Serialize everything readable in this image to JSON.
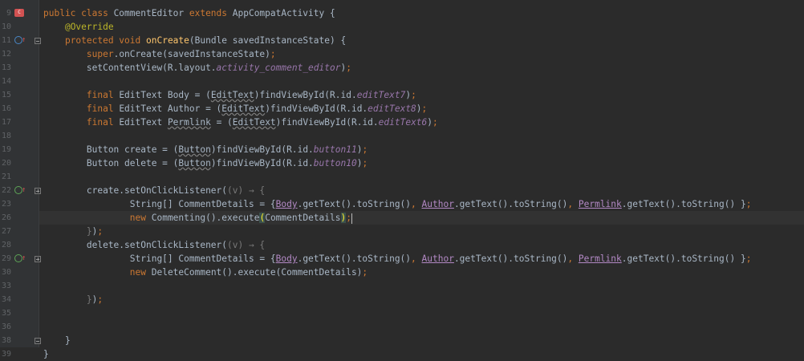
{
  "editor": {
    "line_numbers": [
      "9",
      "10",
      "11",
      "12",
      "13",
      "14",
      "15",
      "16",
      "17",
      "18",
      "19",
      "20",
      "21",
      "22",
      "23",
      "26",
      "27",
      "28",
      "29",
      "30",
      "33",
      "34",
      "35",
      "36",
      "38",
      "39"
    ],
    "lines": [
      {
        "no": "9",
        "tokens": [
          [
            "kw",
            "public class "
          ],
          [
            "",
            "CommentEditor "
          ],
          [
            "kw",
            "extends "
          ],
          [
            "",
            "AppCompatActivity {"
          ]
        ]
      },
      {
        "no": "10",
        "tokens": [
          [
            "",
            "    "
          ],
          [
            "ann",
            "@Override"
          ]
        ]
      },
      {
        "no": "11",
        "tokens": [
          [
            "",
            "    "
          ],
          [
            "kw",
            "protected void "
          ],
          [
            "fn",
            "onCreate"
          ],
          [
            "",
            "(Bundle savedInstanceState) {"
          ]
        ]
      },
      {
        "no": "12",
        "tokens": [
          [
            "",
            "        "
          ],
          [
            "kw",
            "super"
          ],
          [
            "",
            ".onCreate(savedInstanceState)"
          ],
          [
            "kw",
            ";"
          ]
        ]
      },
      {
        "no": "13",
        "tokens": [
          [
            "",
            "        setContentView(R.layout."
          ],
          [
            "fld",
            "activity_comment_editor"
          ],
          [
            "",
            ")"
          ],
          [
            "kw",
            ";"
          ]
        ]
      },
      {
        "no": "14",
        "tokens": []
      },
      {
        "no": "15",
        "tokens": [
          [
            "",
            "        "
          ],
          [
            "kw",
            "final "
          ],
          [
            "",
            "EditText Body = ("
          ],
          [
            "squiggle",
            "EditText"
          ],
          [
            "",
            ")findViewById(R.id."
          ],
          [
            "fld",
            "editText7"
          ],
          [
            "",
            ")"
          ],
          [
            "kw",
            ";"
          ]
        ]
      },
      {
        "no": "16",
        "tokens": [
          [
            "",
            "        "
          ],
          [
            "kw",
            "final "
          ],
          [
            "",
            "EditText Author = ("
          ],
          [
            "squiggle",
            "EditText"
          ],
          [
            "",
            ")findViewById(R.id."
          ],
          [
            "fld",
            "editText8"
          ],
          [
            "",
            ")"
          ],
          [
            "kw",
            ";"
          ]
        ]
      },
      {
        "no": "17",
        "tokens": [
          [
            "",
            "        "
          ],
          [
            "kw",
            "final "
          ],
          [
            "",
            "EditText "
          ],
          [
            "squiggle",
            "Permlink"
          ],
          [
            "",
            " = ("
          ],
          [
            "squiggle",
            "EditText"
          ],
          [
            "",
            ")findViewById(R.id."
          ],
          [
            "fld",
            "editText6"
          ],
          [
            "",
            ")"
          ],
          [
            "kw",
            ";"
          ]
        ]
      },
      {
        "no": "18",
        "tokens": []
      },
      {
        "no": "19",
        "tokens": [
          [
            "",
            "        Button create = ("
          ],
          [
            "squiggle",
            "Button"
          ],
          [
            "",
            ")findViewById(R.id."
          ],
          [
            "fld",
            "button11"
          ],
          [
            "",
            ")"
          ],
          [
            "kw",
            ";"
          ]
        ]
      },
      {
        "no": "20",
        "tokens": [
          [
            "",
            "        Button delete = ("
          ],
          [
            "squiggle",
            "Button"
          ],
          [
            "",
            ")findViewById(R.id."
          ],
          [
            "fld",
            "button10"
          ],
          [
            "",
            ")"
          ],
          [
            "kw",
            ";"
          ]
        ]
      },
      {
        "no": "21",
        "tokens": []
      },
      {
        "no": "22",
        "tokens": [
          [
            "",
            "        create.setOnClickListener("
          ],
          [
            "lamb",
            "(v) → {"
          ]
        ]
      },
      {
        "no": "23",
        "tokens": [
          [
            "",
            "                String[] CommentDetails = {"
          ],
          [
            "lvu",
            "Body"
          ],
          [
            "",
            ".getText().toString()"
          ],
          [
            "kw",
            ", "
          ],
          [
            "lvu",
            "Author"
          ],
          [
            "",
            ".getText().toString()"
          ],
          [
            "kw",
            ", "
          ],
          [
            "lvu",
            "Permlink"
          ],
          [
            "",
            ".getText().toString() }"
          ],
          [
            "kw",
            ";"
          ]
        ]
      },
      {
        "no": "26",
        "tokens": [
          [
            "",
            "                "
          ],
          [
            "kw",
            "new "
          ],
          [
            "",
            "Commenting().execute"
          ],
          [
            "bh",
            "("
          ],
          [
            "",
            "CommentDetails"
          ],
          [
            "bh",
            ")"
          ],
          [
            "kw",
            ";"
          ],
          [
            "caret",
            ""
          ]
        ]
      },
      {
        "no": "27",
        "tokens": [
          [
            "",
            "        "
          ],
          [
            "lamb",
            "}"
          ],
          [
            "",
            ")"
          ],
          [
            "kw",
            ";"
          ]
        ]
      },
      {
        "no": "28",
        "tokens": [
          [
            "",
            "        delete.setOnClickListener("
          ],
          [
            "lamb",
            "(v) → {"
          ]
        ]
      },
      {
        "no": "29",
        "tokens": [
          [
            "",
            "                String[] CommentDetails = {"
          ],
          [
            "lvu",
            "Body"
          ],
          [
            "",
            ".getText().toString()"
          ],
          [
            "kw",
            ", "
          ],
          [
            "lvu",
            "Author"
          ],
          [
            "",
            ".getText().toString()"
          ],
          [
            "kw",
            ", "
          ],
          [
            "lvu",
            "Permlink"
          ],
          [
            "",
            ".getText().toString() }"
          ],
          [
            "kw",
            ";"
          ]
        ]
      },
      {
        "no": "30",
        "tokens": [
          [
            "",
            "                "
          ],
          [
            "kw",
            "new "
          ],
          [
            "",
            "DeleteComment().execute(CommentDetails)"
          ],
          [
            "kw",
            ";"
          ]
        ]
      },
      {
        "no": "33",
        "tokens": []
      },
      {
        "no": "34",
        "tokens": [
          [
            "",
            "        "
          ],
          [
            "lamb",
            "}"
          ],
          [
            "",
            ")"
          ],
          [
            "kw",
            ";"
          ]
        ]
      },
      {
        "no": "35",
        "tokens": []
      },
      {
        "no": "36",
        "tokens": []
      },
      {
        "no": "38",
        "tokens": [
          [
            "",
            "    }"
          ]
        ]
      },
      {
        "no": "39",
        "tokens": [
          [
            "",
            "}"
          ]
        ]
      }
    ],
    "gutter_icons": {
      "9": "class-icon",
      "11": "override-icon",
      "22": "implement-icon",
      "29": "implement-icon",
      "26": "lightbulb-icon"
    },
    "fold_markers": {
      "11": "minus",
      "22": "plus",
      "29": "plus",
      "38": "minus"
    },
    "current_line": "26"
  },
  "colors": {
    "background": "#2b2b2b",
    "keyword": "#cc7832",
    "annotation": "#bbb529",
    "method": "#ffc66d",
    "field": "#9876aa",
    "text": "#a9b7c6"
  }
}
